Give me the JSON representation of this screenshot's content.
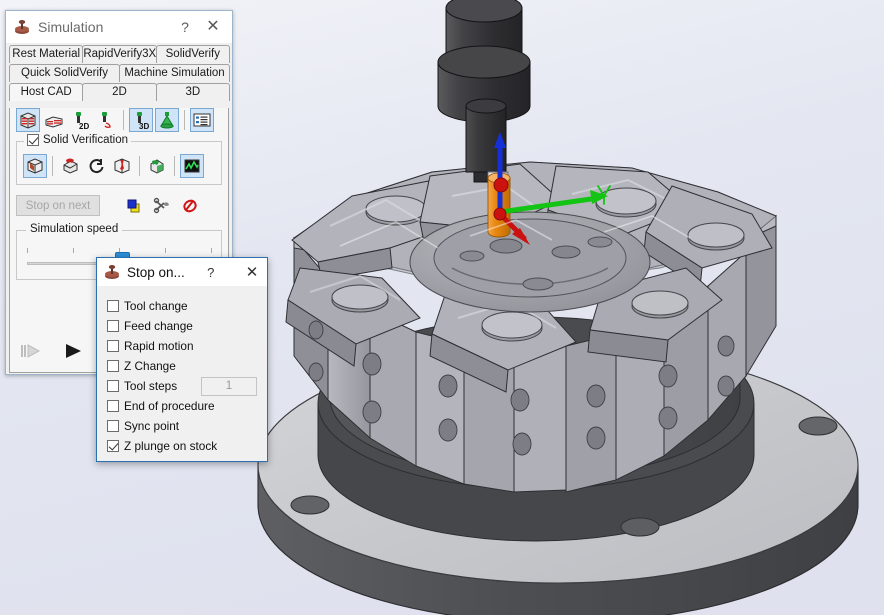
{
  "app": {
    "window_title": "Simulation",
    "help_glyph": "?",
    "close_glyph": "✕"
  },
  "tabs": {
    "row1": [
      {
        "label": "Rest Material",
        "selected": false
      },
      {
        "label": "RapidVerify3X",
        "selected": false
      },
      {
        "label": "SolidVerify",
        "selected": false
      }
    ],
    "row2": [
      {
        "label": "Quick SolidVerify",
        "selected": false
      },
      {
        "label": "Machine Simulation",
        "selected": false
      }
    ],
    "row3": [
      {
        "label": "Host CAD",
        "selected": true
      },
      {
        "label": "2D",
        "selected": false
      },
      {
        "label": "3D",
        "selected": false
      }
    ]
  },
  "toolbar_top": {
    "buttons": [
      {
        "name": "stock-solid-icon",
        "active": true
      },
      {
        "name": "stock-sliced-icon",
        "active": false
      },
      {
        "name": "tool-2d-icon",
        "active": false
      },
      {
        "name": "tool-path-icon",
        "active": false
      },
      {
        "name": "tool-3d-icon",
        "active": true
      },
      {
        "name": "tool-cone-icon",
        "active": true
      },
      {
        "name": "list-view-icon",
        "active": true
      }
    ]
  },
  "solid_verification": {
    "label": "Solid Verification",
    "checked": true,
    "buttons": [
      {
        "name": "cube-view-icon",
        "active": true
      },
      {
        "name": "section-cut-icon",
        "active": false
      },
      {
        "name": "rotate-icon",
        "active": false
      },
      {
        "name": "compare-icon",
        "active": false
      },
      {
        "name": "shade-icon",
        "active": false
      },
      {
        "name": "analyze-icon",
        "active": true
      }
    ]
  },
  "controls": {
    "stop_on_next_label": "Stop on next",
    "stop_on_next_disabled": true,
    "icons": [
      {
        "name": "color-swatch-icon"
      },
      {
        "name": "tools-icon"
      },
      {
        "name": "eraser-icon"
      }
    ]
  },
  "simulation_speed": {
    "label": "Simulation speed",
    "value_percent": 55,
    "tick_count": 5
  },
  "playback": {
    "step_label": "step",
    "step_enabled": false,
    "play_label": "play",
    "play_enabled": true
  },
  "stop_dialog": {
    "title": "Stop on...",
    "help_glyph": "?",
    "close_glyph": "✕",
    "options": [
      {
        "label": "Tool change",
        "checked": false
      },
      {
        "label": "Feed change",
        "checked": false
      },
      {
        "label": "Rapid motion",
        "checked": false
      },
      {
        "label": "Z Change",
        "checked": false
      },
      {
        "label": "Tool steps",
        "checked": false,
        "field_value": "1"
      },
      {
        "label": "End of procedure",
        "checked": false
      },
      {
        "label": "Sync point",
        "checked": false
      },
      {
        "label": "Z plunge on stock",
        "checked": true
      }
    ]
  },
  "viewport": {
    "scene_name": "cnc-chuck-fixture-simulation",
    "background_top": "#eef0f6",
    "background_bottom": "#e9ebf2",
    "axes": [
      {
        "name": "z-axis",
        "color": "#1530d8"
      },
      {
        "name": "y-axis",
        "color": "#14c414"
      },
      {
        "name": "x-axis",
        "color": "#cc1111"
      }
    ],
    "tool_holder_color": "#3a3a3c",
    "tool_flute_color": "#e8870f",
    "fixture_color": "#a8a9ae",
    "base_plate_color": "#c9cacd"
  }
}
